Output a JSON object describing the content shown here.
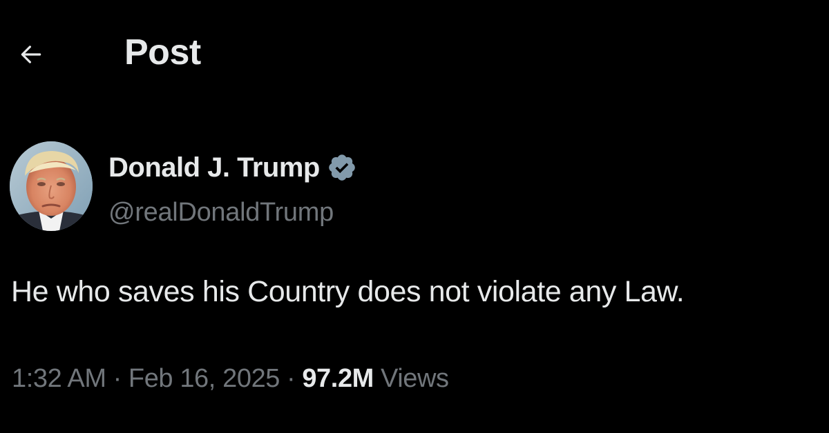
{
  "header": {
    "back_icon": "arrow-left-icon",
    "title": "Post"
  },
  "author": {
    "display_name": "Donald J. Trump",
    "handle": "@realDonaldTrump",
    "verified_icon": "verified-badge-icon",
    "avatar_icon": "profile-photo"
  },
  "post": {
    "text": "He who saves his Country does not violate any Law.",
    "time": "1:32 AM",
    "separator": "·",
    "date": "Feb 16, 2025",
    "views_count": "97.2M",
    "views_label": "Views"
  },
  "colors": {
    "background": "#000000",
    "primary_text": "#e7e9ea",
    "secondary_text": "#71767b",
    "verified_badge": "#829aab"
  }
}
